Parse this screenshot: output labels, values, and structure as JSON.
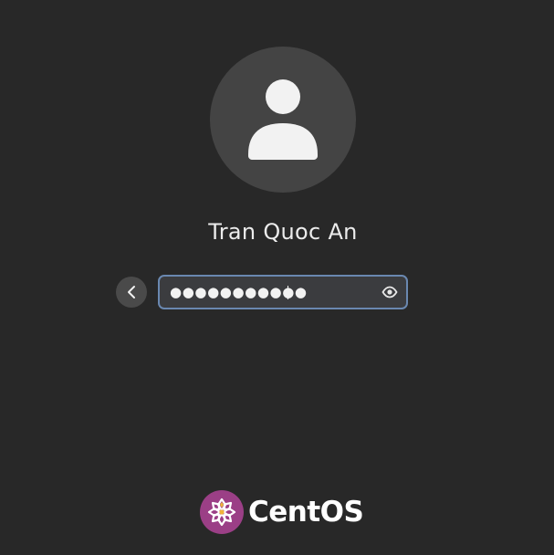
{
  "user": {
    "name": "Tran Quoc An",
    "avatar_icon": "user-silhouette-icon"
  },
  "login": {
    "back_icon": "chevron-left-icon",
    "password_masked": "●●●●●●●●●●●",
    "reveal_icon": "eye-icon",
    "focus_color": "#6a88b0"
  },
  "brand": {
    "logo_icon": "centos-flower-logo",
    "name": "CentOS",
    "logo_color": "#9b3f86"
  }
}
